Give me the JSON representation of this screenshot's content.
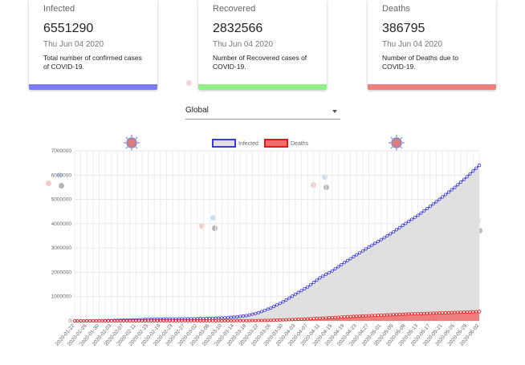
{
  "cards": [
    {
      "id": "infected",
      "title": "Infected",
      "value": "6551290",
      "date": "Thu Jun 04 2020",
      "description": "Total number of confirmed cases of COVID-19.",
      "bar_color": "#7b7bff"
    },
    {
      "id": "recovered",
      "title": "Recovered",
      "value": "2832566",
      "date": "Thu Jun 04 2020",
      "description": "Number of Recovered cases of COVID-19.",
      "bar_color": "#8ff08a"
    },
    {
      "id": "deaths",
      "title": "Deaths",
      "value": "386795",
      "date": "Thu Jun 04 2020",
      "description": "Number of Deaths due to COVID-19.",
      "bar_color": "#f07f7f"
    }
  ],
  "country_select": {
    "selected": "Global"
  },
  "chart_data": {
    "type": "line",
    "title": "",
    "legend": [
      "Infected",
      "Deaths"
    ],
    "legend_position": "top",
    "ylim": [
      0,
      7000000
    ],
    "yticks": [
      "0",
      "1000000",
      "2000000",
      "3000000",
      "4000000",
      "5000000",
      "6000000",
      "7000000"
    ],
    "x_labels": [
      "2020-01-22",
      "2020-01-26",
      "2020-01-30",
      "2020-02-03",
      "2020-02-07",
      "2020-02-11",
      "2020-02-15",
      "2020-02-19",
      "2020-02-23",
      "2020-02-27",
      "2020-03-02",
      "2020-03-06",
      "2020-03-10",
      "2020-03-14",
      "2020-03-18",
      "2020-03-22",
      "2020-03-26",
      "2020-03-30",
      "2020-04-03",
      "2020-04-07",
      "2020-04-11",
      "2020-04-15",
      "2020-04-19",
      "2020-04-23",
      "2020-04-27",
      "2020-05-01",
      "2020-05-05",
      "2020-05-09",
      "2020-05-13",
      "2020-05-17",
      "2020-05-21",
      "2020-05-25",
      "2020-05-29",
      "2020-06-02"
    ],
    "series": [
      {
        "name": "Infected",
        "color": "#3b3bd6",
        "fill": "#e0e0e0",
        "values": [
          555,
          2118,
          7783,
          17391,
          31261,
          43109,
          67093,
          75641,
          78985,
          83348,
          90306,
          101799,
          118592,
          156101,
          214910,
          336953,
          529591,
          782365,
          1095917,
          1396476,
          1771514,
          2056055,
          2401378,
          2719897,
          3041764,
          3343777,
          3662691,
          4013685,
          4347015,
          4713620,
          5102424,
          5495061,
          5934936,
          6404000
        ]
      },
      {
        "name": "Deaths",
        "color": "#e31a1a",
        "fill": "#f26b6b",
        "values": [
          17,
          56,
          170,
          362,
          637,
          1018,
          1526,
          2122,
          2469,
          2858,
          3160,
          3460,
          4262,
          5819,
          8790,
          14725,
          24057,
          40684,
          59172,
          82074,
          108502,
          133354,
          165069,
          190858,
          211609,
          235290,
          256766,
          278719,
          297284,
          315185,
          328115,
          346232,
          365005,
          383000
        ]
      }
    ]
  }
}
